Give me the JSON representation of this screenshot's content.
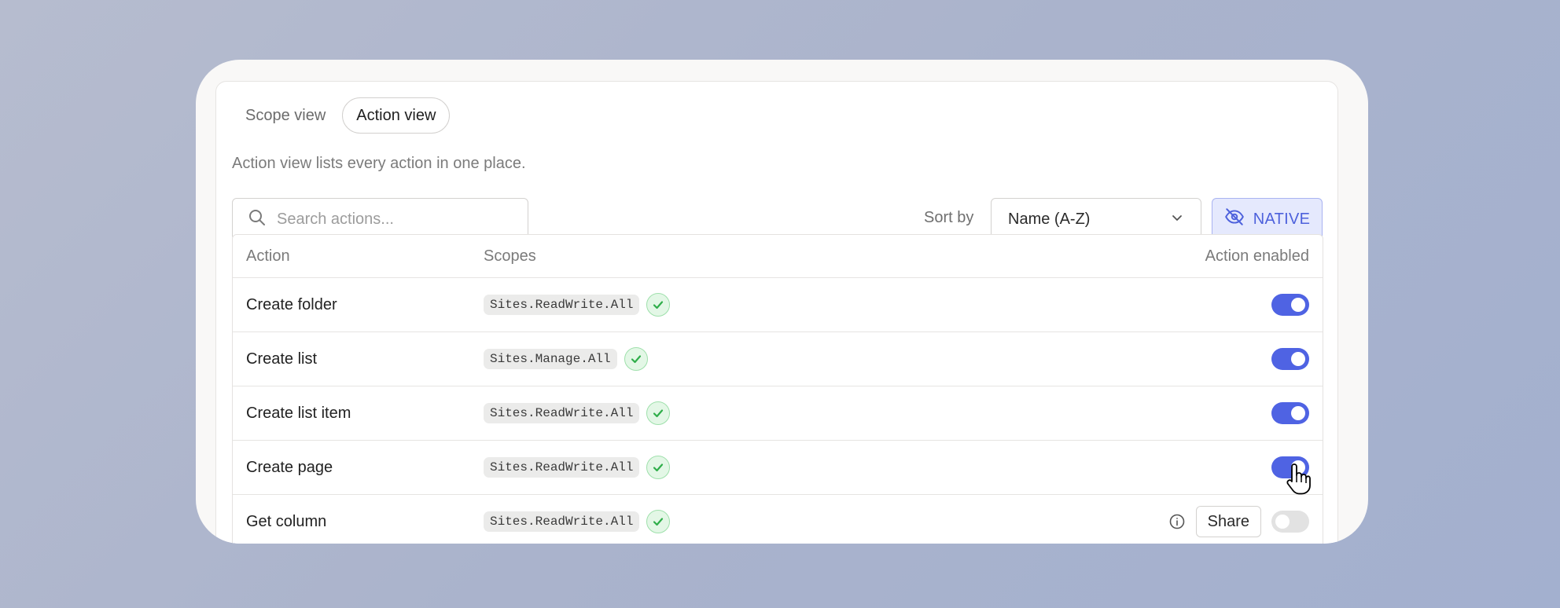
{
  "tabs": [
    {
      "label": "Scope view",
      "active": false
    },
    {
      "label": "Action view",
      "active": true
    }
  ],
  "description": "Action view lists every action in one place.",
  "search": {
    "placeholder": "Search actions...",
    "value": "",
    "icon": "search-icon"
  },
  "sort": {
    "label": "Sort by",
    "selected": "Name (A-Z)",
    "icon": "chevron-down-icon"
  },
  "native_button": {
    "label": "NATIVE",
    "icon": "eye-off-icon"
  },
  "colors": {
    "accent": "#4f63e3",
    "native_bg": "#e5e9fd",
    "native_text": "#4d61dc",
    "check_bg": "#e3f7e6",
    "check_icon": "#2fae4a"
  },
  "table": {
    "headers": {
      "action": "Action",
      "scopes": "Scopes",
      "enabled": "Action enabled"
    },
    "rows": [
      {
        "action": "Create folder",
        "scope": "Sites.ReadWrite.All",
        "enabled": true
      },
      {
        "action": "Create list",
        "scope": "Sites.Manage.All",
        "enabled": true
      },
      {
        "action": "Create list item",
        "scope": "Sites.ReadWrite.All",
        "enabled": true
      },
      {
        "action": "Create page",
        "scope": "Sites.ReadWrite.All",
        "enabled": true
      },
      {
        "action": "Get column",
        "scope": "Sites.ReadWrite.All",
        "enabled": false,
        "share_label": "Share",
        "info_icon": "info-icon"
      }
    ]
  }
}
